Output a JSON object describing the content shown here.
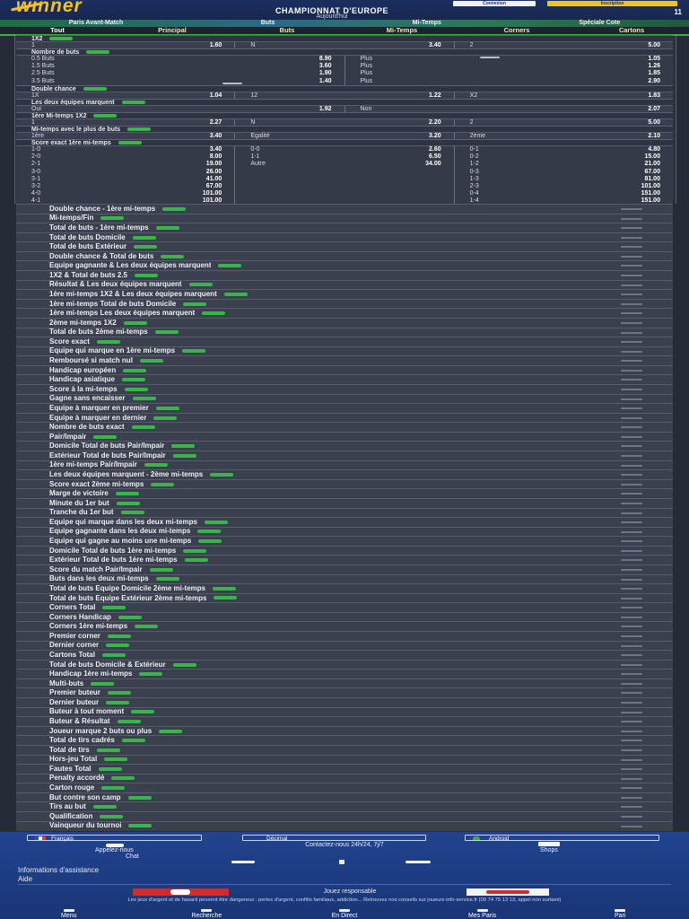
{
  "header": {
    "logo": "winner",
    "title": "CHAMPIONNAT D'EUROPE",
    "subtitle": "Aujourd'hui",
    "login": "Connexion",
    "register": "Inscription",
    "count": "11"
  },
  "subnav": [
    "Paris Avant-Match",
    "Buts",
    "Mi-Temps",
    "Spéciale Cote"
  ],
  "tabs": [
    "Tout",
    "Principal",
    "Buts",
    "Mi-Temps",
    "Corners",
    "Cartons"
  ],
  "markets": {
    "m1": {
      "title": "1X2",
      "odds": [
        {
          "label": "1",
          "value": "1.60"
        },
        {
          "label": "N",
          "value": "3.40"
        },
        {
          "label": "2",
          "value": "5.00"
        }
      ]
    },
    "m2": {
      "title": "Nombre de buts",
      "left": [
        {
          "label": "0.5 Buts",
          "value": "8.90"
        },
        {
          "label": "1.5 Buts",
          "value": "3.60"
        },
        {
          "label": "2.5 Buts",
          "value": "1.90"
        },
        {
          "label": "3.5 Buts",
          "value": "1.40"
        }
      ],
      "right": [
        {
          "label": "Plus",
          "value": "1.05"
        },
        {
          "label": "Plus",
          "value": "1.26"
        },
        {
          "label": "Plus",
          "value": "1.85"
        },
        {
          "label": "Plus",
          "value": "2.90"
        }
      ]
    },
    "m3": {
      "title": "Double chance",
      "odds": [
        {
          "label": "1X",
          "value": "1.04"
        },
        {
          "label": "12",
          "value": "1.22"
        },
        {
          "label": "X2",
          "value": "1.83"
        }
      ]
    },
    "m4": {
      "title": "Les deux équipes marquent",
      "odds": [
        {
          "label": "Oui",
          "value": "1.92"
        },
        {
          "label": "Non",
          "value": "2.07"
        }
      ]
    },
    "m5": {
      "title": "1ère Mi-temps 1X2",
      "odds": [
        {
          "label": "1",
          "value": "2.27"
        },
        {
          "label": "N",
          "value": "2.20"
        },
        {
          "label": "2",
          "value": "5.00"
        }
      ]
    },
    "m6": {
      "title": "Mi-temps avec le plus de buts",
      "odds": [
        {
          "label": "1ère",
          "value": "3.40"
        },
        {
          "label": "Egalité",
          "value": "3.20"
        },
        {
          "label": "2ème",
          "value": "2.10"
        }
      ]
    },
    "m7": {
      "title": "Score exact 1ère mi-temps",
      "cols": [
        [
          {
            "label": "1-0",
            "value": "3.40"
          },
          {
            "label": "2-0",
            "value": "8.00"
          },
          {
            "label": "2-1",
            "value": "19.00"
          },
          {
            "label": "3-0",
            "value": "26.00"
          },
          {
            "label": "3-1",
            "value": "41.00"
          },
          {
            "label": "3-2",
            "value": "67.00"
          },
          {
            "label": "4-0",
            "value": "101.00"
          },
          {
            "label": "4-1",
            "value": "101.00"
          }
        ],
        [
          {
            "label": "0-0",
            "value": "2.60"
          },
          {
            "label": "1-1",
            "value": "6.50"
          },
          {
            "label": "Autre",
            "value": "34.00"
          }
        ],
        [
          {
            "label": "0-1",
            "value": "4.80"
          },
          {
            "label": "0-2",
            "value": "15.00"
          },
          {
            "label": "1-2",
            "value": "21.00"
          },
          {
            "label": "0-3",
            "value": "67.00"
          },
          {
            "label": "1-3",
            "value": "81.00"
          },
          {
            "label": "2-3",
            "value": "101.00"
          },
          {
            "label": "0-4",
            "value": "151.00"
          },
          {
            "label": "1-4",
            "value": "151.00"
          }
        ]
      ]
    }
  },
  "market_list": [
    "Double chance - 1ère mi-temps",
    "Mi-temps/Fin",
    "Total de buts - 1ère mi-temps",
    "Total de buts Domicile",
    "Total de buts Extérieur",
    "Double chance & Total de buts",
    "Equipe gagnante & Les deux équipes marquent",
    "1X2 & Total de buts 2.5",
    "Résultat & Les deux équipes marquent",
    "1ère mi-temps 1X2 & Les deux équipes marquent",
    "1ère mi-temps Total de buts Domicile",
    "1ère mi-temps Les deux équipes marquent",
    "2ème mi-temps 1X2",
    "Total de buts 2ème mi-temps",
    "Score exact",
    "Equipe qui marque en 1ère mi-temps",
    "Remboursé si match nul",
    "Handicap européen",
    "Handicap asiatique",
    "Score à la mi-temps",
    "Gagne sans encaisser",
    "Equipe à marquer en premier",
    "Equipe à marquer en dernier",
    "Nombre de buts exact",
    "Pair/Impair",
    "Domicile Total de buts Pair/Impair",
    "Extérieur Total de buts Pair/Impair",
    "1ère mi-temps Pair/Impair",
    "Les deux équipes marquent - 2ème mi-temps",
    "Score exact 2ème mi-temps",
    "Marge de victoire",
    "Minute du 1er but",
    "Tranche du 1er but",
    "Equipe qui marque dans les deux mi-temps",
    "Equipe gagnante dans les deux mi-temps",
    "Equipe qui gagne au moins une mi-temps",
    "Domicile Total de buts 1ère mi-temps",
    "Extérieur Total de buts 1ère mi-temps",
    "Score du match Pair/Impair",
    "Buts dans les deux mi-temps",
    "Total de buts Equipe Domicile 2ème mi-temps",
    "Total de buts Equipe Extérieur 2ème mi-temps",
    "Corners Total",
    "Corners Handicap",
    "Corners 1ère mi-temps",
    "Premier corner",
    "Dernier corner",
    "Cartons Total",
    "Total de buts Domicile & Extérieur",
    "Handicap 1ère mi-temps",
    "Multi-buts",
    "Premier buteur",
    "Dernier buteur",
    "Buteur à tout moment",
    "Buteur & Résultat",
    "Joueur marque 2 buts ou plus",
    "Total de tirs cadrés",
    "Total de tirs",
    "Hors-jeu Total",
    "Fautes Total",
    "Penalty accordé",
    "Carton rouge",
    "But contre son camp",
    "Tirs au but",
    "Qualification",
    "Vainqueur du tournoi"
  ],
  "footer": {
    "language": "Français",
    "odds_format": "Décimal",
    "app": "Android",
    "contact": "Contactez-nous 24h/24, 7j/7",
    "call": "Appelez-nous",
    "chat": "Chat",
    "shops": "Shops",
    "support_title": "Informations d'assistance",
    "help": "Aide",
    "responsible": "Jouez responsable",
    "disclaimer": "Les jeux d'argent et de hasard peuvent être dangereux : pertes d'argent, conflits familiaux, addiction... Retrouvez nos conseils sur joueurs-info-service.fr (09 74 75 13 13, appel non surtaxé)"
  },
  "bottom_nav": [
    "Menu",
    "Recherche",
    "En Direct",
    "Mes Paris",
    "Pari"
  ],
  "colors": {
    "header": "#1b2e5f",
    "brand_yellow": "#f4c21c",
    "accent_green": "#39b54a",
    "page_bg": "#262b38",
    "footer": "#21448f"
  }
}
